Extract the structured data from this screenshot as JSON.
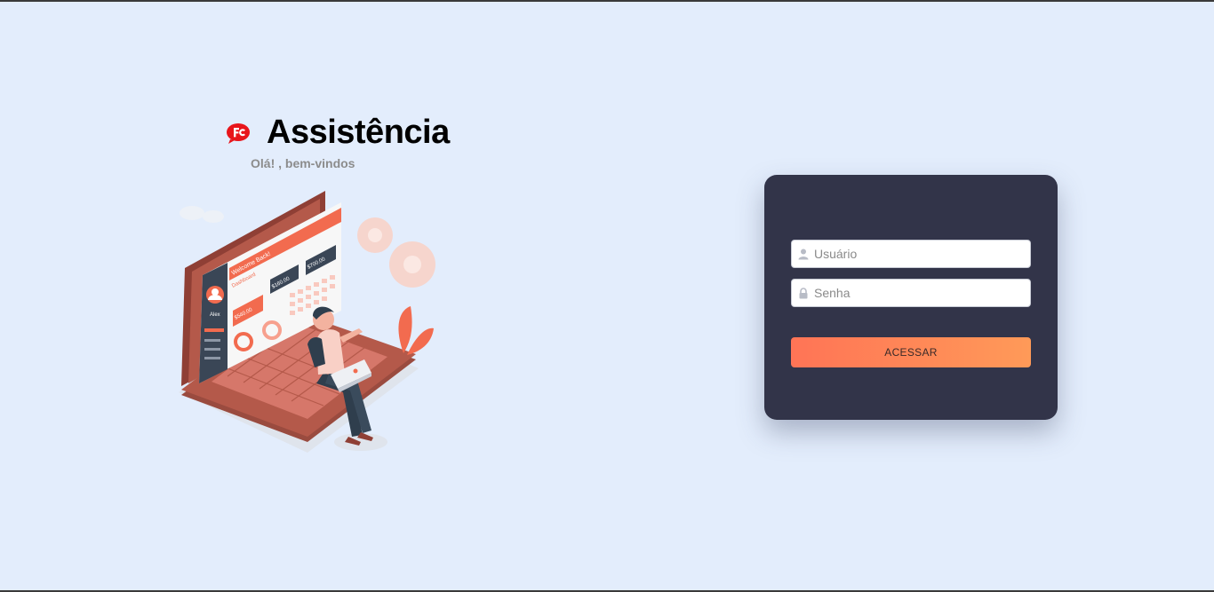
{
  "brand": {
    "title": "Assistência",
    "subtitle": "Olá! , bem-vindos",
    "logo_icon": "fc-logo-icon",
    "logo_color": "#e8151b"
  },
  "illustration": {
    "icon": "laptop-dashboard-illustration",
    "screen_texts": {
      "welcome": "Welcome Back!",
      "dashboard": "Dashboard",
      "user": "Alex",
      "amount1": "$540.00",
      "amount2": "$160.00",
      "amount3": "$700.00"
    }
  },
  "login": {
    "username_placeholder": "Usuário",
    "username_value": "",
    "password_placeholder": "Senha",
    "password_value": "",
    "submit_label": "ACESSAR",
    "user_icon": "user-icon",
    "lock_icon": "lock-icon"
  },
  "colors": {
    "background": "#e3edfc",
    "card": "#323449",
    "button_start": "#ff7456",
    "button_end": "#ff9a58",
    "accent": "#f26b4f"
  }
}
